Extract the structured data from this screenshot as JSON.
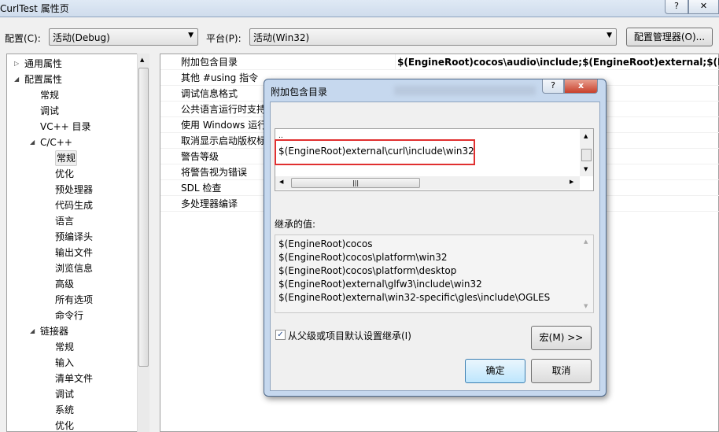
{
  "window": {
    "title": "CurlTest 属性页",
    "help_btn": "?",
    "close_btn": "✕"
  },
  "toolbar": {
    "config_label": "配置(C):",
    "config_value": "活动(Debug)",
    "platform_label": "平台(P):",
    "platform_value": "活动(Win32)",
    "config_manager": "配置管理器(O)..."
  },
  "tree": {
    "items": [
      {
        "label": "通用属性",
        "level": 0,
        "toggle": "collapsed"
      },
      {
        "label": "配置属性",
        "level": 0,
        "toggle": "expanded"
      },
      {
        "label": "常规",
        "level": 1
      },
      {
        "label": "调试",
        "level": 1
      },
      {
        "label": "VC++ 目录",
        "level": 1
      },
      {
        "label": "C/C++",
        "level": 1,
        "toggle": "expanded"
      },
      {
        "label": "常规",
        "level": 2,
        "selected": true
      },
      {
        "label": "优化",
        "level": 2
      },
      {
        "label": "预处理器",
        "level": 2
      },
      {
        "label": "代码生成",
        "level": 2
      },
      {
        "label": "语言",
        "level": 2
      },
      {
        "label": "预编译头",
        "level": 2
      },
      {
        "label": "输出文件",
        "level": 2
      },
      {
        "label": "浏览信息",
        "level": 2
      },
      {
        "label": "高级",
        "level": 2
      },
      {
        "label": "所有选项",
        "level": 2
      },
      {
        "label": "命令行",
        "level": 2
      },
      {
        "label": "链接器",
        "level": 1,
        "toggle": "expanded"
      },
      {
        "label": "常规",
        "level": 2
      },
      {
        "label": "输入",
        "level": 2
      },
      {
        "label": "清单文件",
        "level": 2
      },
      {
        "label": "调试",
        "level": 2
      },
      {
        "label": "系统",
        "level": 2
      },
      {
        "label": "优化",
        "level": 2
      }
    ]
  },
  "grid": {
    "rows": [
      {
        "name": "附加包含目录",
        "value": "$(EngineRoot)cocos\\audio\\include;$(EngineRoot)external;$(Engin"
      },
      {
        "name": "其他 #using 指令",
        "value": ""
      },
      {
        "name": "调试信息格式",
        "value": ""
      },
      {
        "name": "公共语言运行时支持",
        "value": ""
      },
      {
        "name": "使用 Windows 运行",
        "value": ""
      },
      {
        "name": "取消显示启动版权标",
        "value": ""
      },
      {
        "name": "警告等级",
        "value": ""
      },
      {
        "name": "将警告视为错误",
        "value": ""
      },
      {
        "name": "SDL 检查",
        "value": ""
      },
      {
        "name": "多处理器编译",
        "value": ""
      }
    ]
  },
  "dialog": {
    "title": "附加包含目录",
    "help_btn": "?",
    "close_btn": "x",
    "toolbar_icons": [
      "new-folder-icon",
      "delete-icon",
      "move-down-icon",
      "move-up-icon"
    ],
    "entries": [
      "..",
      "$(EngineRoot)external\\curl\\include\\win32"
    ],
    "highlight_color": "#e03030",
    "inherited_label": "继承的值:",
    "inherited": [
      "$(EngineRoot)cocos",
      "$(EngineRoot)cocos\\platform\\win32",
      "$(EngineRoot)cocos\\platform\\desktop",
      "$(EngineRoot)external\\glfw3\\include\\win32",
      "$(EngineRoot)external\\win32-specific\\gles\\include\\OGLES"
    ],
    "inherit_checkbox": {
      "label": "从父级或项目默认设置继承(I)",
      "checked": true
    },
    "macro_btn": "宏(M) >>",
    "ok_btn": "确定",
    "cancel_btn": "取消"
  }
}
